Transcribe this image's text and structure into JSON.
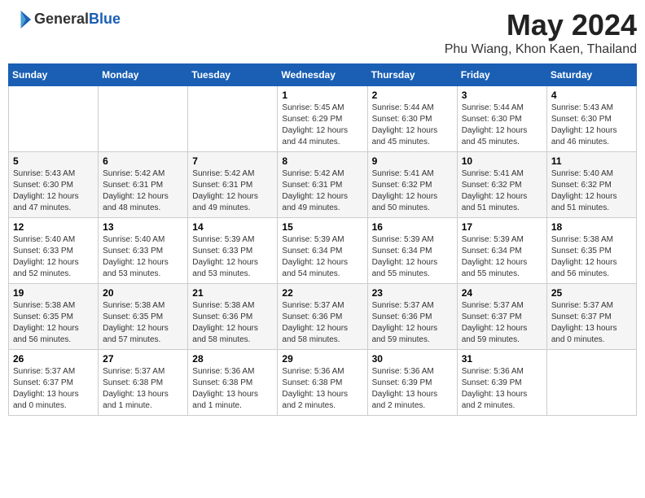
{
  "logo": {
    "text_general": "General",
    "text_blue": "Blue"
  },
  "title": {
    "month_year": "May 2024",
    "location": "Phu Wiang, Khon Kaen, Thailand"
  },
  "weekdays": [
    "Sunday",
    "Monday",
    "Tuesday",
    "Wednesday",
    "Thursday",
    "Friday",
    "Saturday"
  ],
  "weeks": [
    [
      {
        "day": "",
        "info": ""
      },
      {
        "day": "",
        "info": ""
      },
      {
        "day": "",
        "info": ""
      },
      {
        "day": "1",
        "info": "Sunrise: 5:45 AM\nSunset: 6:29 PM\nDaylight: 12 hours\nand 44 minutes."
      },
      {
        "day": "2",
        "info": "Sunrise: 5:44 AM\nSunset: 6:30 PM\nDaylight: 12 hours\nand 45 minutes."
      },
      {
        "day": "3",
        "info": "Sunrise: 5:44 AM\nSunset: 6:30 PM\nDaylight: 12 hours\nand 45 minutes."
      },
      {
        "day": "4",
        "info": "Sunrise: 5:43 AM\nSunset: 6:30 PM\nDaylight: 12 hours\nand 46 minutes."
      }
    ],
    [
      {
        "day": "5",
        "info": "Sunrise: 5:43 AM\nSunset: 6:30 PM\nDaylight: 12 hours\nand 47 minutes."
      },
      {
        "day": "6",
        "info": "Sunrise: 5:42 AM\nSunset: 6:31 PM\nDaylight: 12 hours\nand 48 minutes."
      },
      {
        "day": "7",
        "info": "Sunrise: 5:42 AM\nSunset: 6:31 PM\nDaylight: 12 hours\nand 49 minutes."
      },
      {
        "day": "8",
        "info": "Sunrise: 5:42 AM\nSunset: 6:31 PM\nDaylight: 12 hours\nand 49 minutes."
      },
      {
        "day": "9",
        "info": "Sunrise: 5:41 AM\nSunset: 6:32 PM\nDaylight: 12 hours\nand 50 minutes."
      },
      {
        "day": "10",
        "info": "Sunrise: 5:41 AM\nSunset: 6:32 PM\nDaylight: 12 hours\nand 51 minutes."
      },
      {
        "day": "11",
        "info": "Sunrise: 5:40 AM\nSunset: 6:32 PM\nDaylight: 12 hours\nand 51 minutes."
      }
    ],
    [
      {
        "day": "12",
        "info": "Sunrise: 5:40 AM\nSunset: 6:33 PM\nDaylight: 12 hours\nand 52 minutes."
      },
      {
        "day": "13",
        "info": "Sunrise: 5:40 AM\nSunset: 6:33 PM\nDaylight: 12 hours\nand 53 minutes."
      },
      {
        "day": "14",
        "info": "Sunrise: 5:39 AM\nSunset: 6:33 PM\nDaylight: 12 hours\nand 53 minutes."
      },
      {
        "day": "15",
        "info": "Sunrise: 5:39 AM\nSunset: 6:34 PM\nDaylight: 12 hours\nand 54 minutes."
      },
      {
        "day": "16",
        "info": "Sunrise: 5:39 AM\nSunset: 6:34 PM\nDaylight: 12 hours\nand 55 minutes."
      },
      {
        "day": "17",
        "info": "Sunrise: 5:39 AM\nSunset: 6:34 PM\nDaylight: 12 hours\nand 55 minutes."
      },
      {
        "day": "18",
        "info": "Sunrise: 5:38 AM\nSunset: 6:35 PM\nDaylight: 12 hours\nand 56 minutes."
      }
    ],
    [
      {
        "day": "19",
        "info": "Sunrise: 5:38 AM\nSunset: 6:35 PM\nDaylight: 12 hours\nand 56 minutes."
      },
      {
        "day": "20",
        "info": "Sunrise: 5:38 AM\nSunset: 6:35 PM\nDaylight: 12 hours\nand 57 minutes."
      },
      {
        "day": "21",
        "info": "Sunrise: 5:38 AM\nSunset: 6:36 PM\nDaylight: 12 hours\nand 58 minutes."
      },
      {
        "day": "22",
        "info": "Sunrise: 5:37 AM\nSunset: 6:36 PM\nDaylight: 12 hours\nand 58 minutes."
      },
      {
        "day": "23",
        "info": "Sunrise: 5:37 AM\nSunset: 6:36 PM\nDaylight: 12 hours\nand 59 minutes."
      },
      {
        "day": "24",
        "info": "Sunrise: 5:37 AM\nSunset: 6:37 PM\nDaylight: 12 hours\nand 59 minutes."
      },
      {
        "day": "25",
        "info": "Sunrise: 5:37 AM\nSunset: 6:37 PM\nDaylight: 13 hours\nand 0 minutes."
      }
    ],
    [
      {
        "day": "26",
        "info": "Sunrise: 5:37 AM\nSunset: 6:37 PM\nDaylight: 13 hours\nand 0 minutes."
      },
      {
        "day": "27",
        "info": "Sunrise: 5:37 AM\nSunset: 6:38 PM\nDaylight: 13 hours\nand 1 minute."
      },
      {
        "day": "28",
        "info": "Sunrise: 5:36 AM\nSunset: 6:38 PM\nDaylight: 13 hours\nand 1 minute."
      },
      {
        "day": "29",
        "info": "Sunrise: 5:36 AM\nSunset: 6:38 PM\nDaylight: 13 hours\nand 2 minutes."
      },
      {
        "day": "30",
        "info": "Sunrise: 5:36 AM\nSunset: 6:39 PM\nDaylight: 13 hours\nand 2 minutes."
      },
      {
        "day": "31",
        "info": "Sunrise: 5:36 AM\nSunset: 6:39 PM\nDaylight: 13 hours\nand 2 minutes."
      },
      {
        "day": "",
        "info": ""
      }
    ]
  ]
}
